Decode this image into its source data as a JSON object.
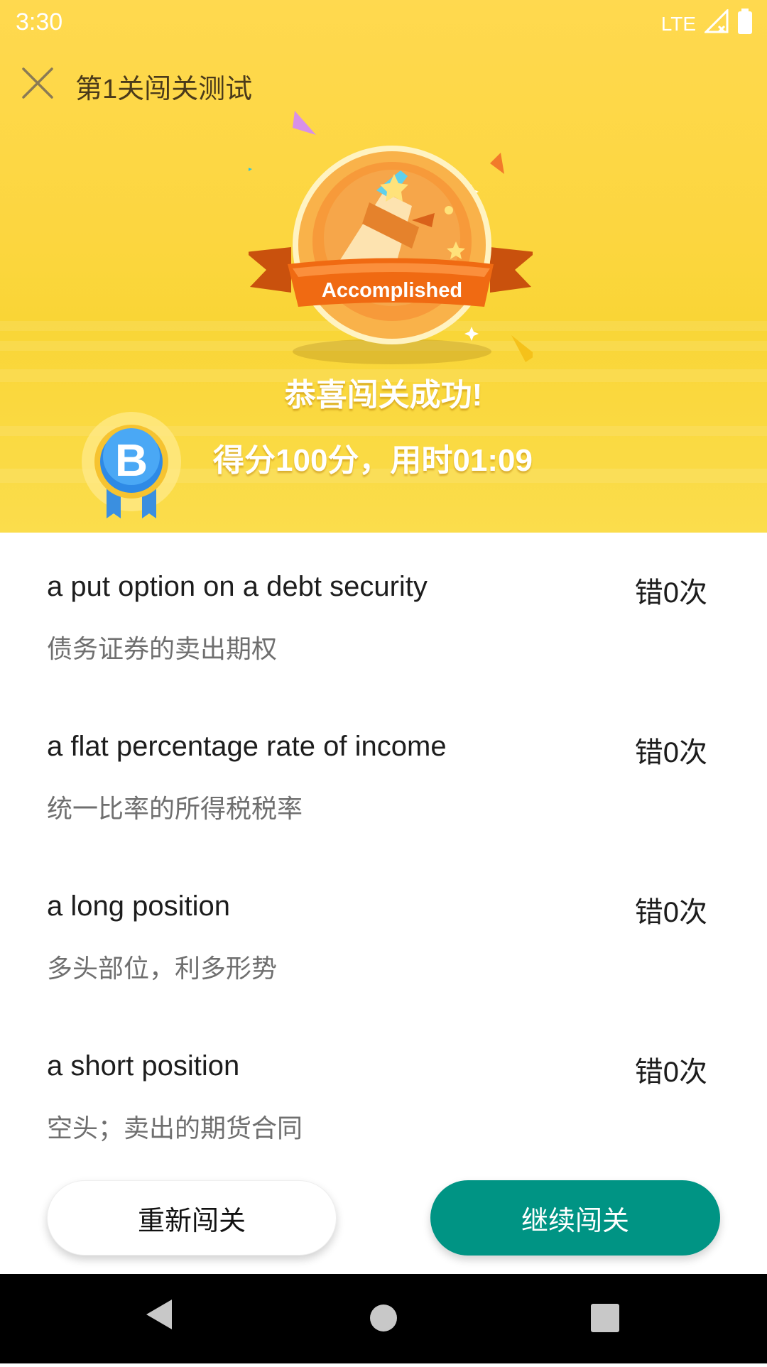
{
  "status_bar": {
    "time": "3:30",
    "network": "LTE"
  },
  "header": {
    "title": "第1关闯关测试"
  },
  "medal": {
    "label": "Accomplished"
  },
  "result": {
    "congrats": "恭喜闯关成功!",
    "score_text": "得分100分，用时01:09",
    "grade": "B"
  },
  "words": [
    {
      "word": "a put option on a debt security",
      "meaning": "债务证券的卖出期权",
      "errors": "错0次"
    },
    {
      "word": "a flat percentage rate of income",
      "meaning": "统一比率的所得税税率",
      "errors": "错0次"
    },
    {
      "word": "a long position",
      "meaning": "多头部位，利多形势",
      "errors": "错0次"
    },
    {
      "word": "a short position",
      "meaning": "空头；卖出的期货合同",
      "errors": "错0次"
    }
  ],
  "buttons": {
    "retry": "重新闯关",
    "continue": "继续闯关"
  },
  "colors": {
    "hero": "#fcd63f",
    "primary": "#009484",
    "ribbon": "#f06a12"
  }
}
